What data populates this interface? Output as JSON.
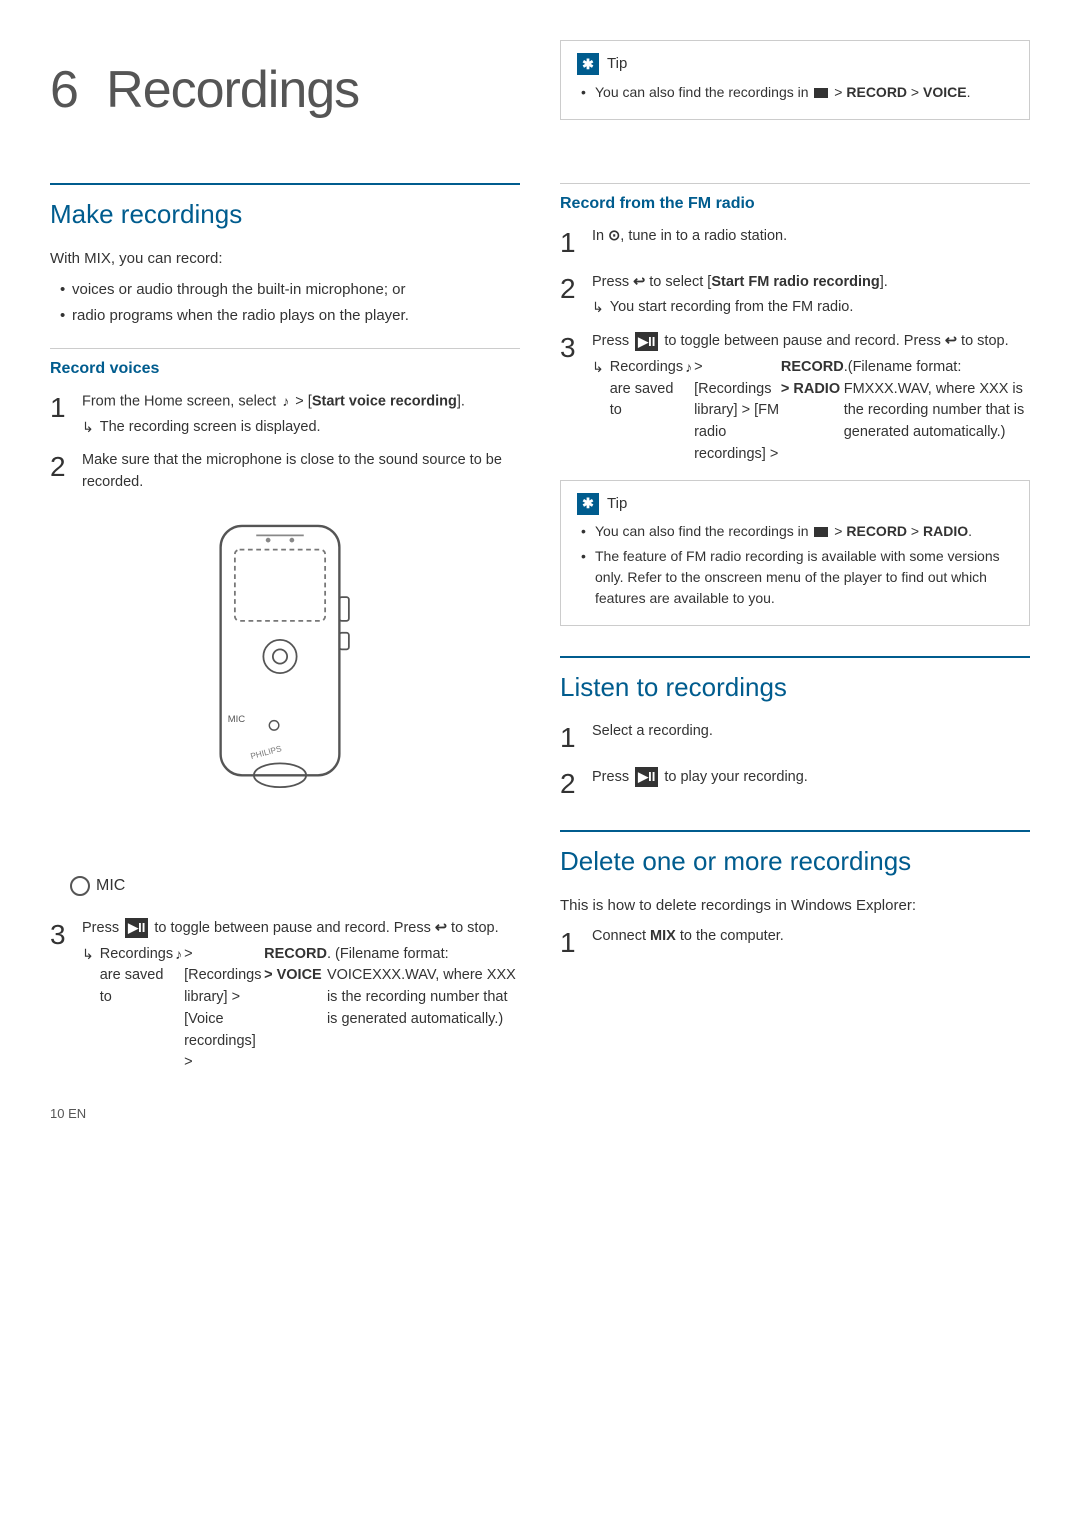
{
  "page": {
    "chapter_number": "6",
    "chapter_title": "Recordings",
    "footer": "10    EN"
  },
  "tip_top": {
    "label": "Tip",
    "items": [
      "You can also find the recordings in ■ > RECORD > VOICE."
    ]
  },
  "make_recordings": {
    "section_title": "Make recordings",
    "intro": "With MIX, you can record:",
    "bullets": [
      "voices or audio through the built-in microphone; or",
      "radio programs when the radio plays on the player."
    ],
    "record_voices": {
      "subtitle": "Record voices",
      "steps": [
        {
          "num": "1",
          "text": "From the Home screen, select ♪ > [Start voice recording].",
          "note": "The recording screen is displayed."
        },
        {
          "num": "2",
          "text": "Make sure that the microphone is close to the sound source to be recorded."
        },
        {
          "num": "3",
          "text": "Press ▶II to toggle between pause and record. Press ↩ to stop.",
          "note": "Recordings are saved to ♪ > [Recordings library] > [Voice recordings] > RECORD > VOICE. (Filename format: VOICEXXX.WAV, where XXX is the recording number that is generated automatically.)"
        }
      ]
    }
  },
  "record_fm": {
    "subtitle": "Record from the FM radio",
    "steps": [
      {
        "num": "1",
        "text": "In ⊙, tune in to a radio station."
      },
      {
        "num": "2",
        "text": "Press ↩ to select [Start FM radio recording].",
        "note": "You start recording from the FM radio."
      },
      {
        "num": "3",
        "text": "Press ▶II to toggle between pause and record. Press ↩ to stop.",
        "note": "Recordings are saved to ♪ > [Recordings library] > [FM radio recordings] > RECORD > RADIO.(Filename format: FMXXX.WAV, where XXX is the recording number that is generated automatically.)"
      }
    ]
  },
  "tip_radio": {
    "label": "Tip",
    "items": [
      "You can also find the recordings in ■ > RECORD > RADIO.",
      "The feature of FM radio recording is available with some versions only. Refer to the onscreen menu of the player to find out which features are available to you."
    ]
  },
  "listen_recordings": {
    "section_title": "Listen to recordings",
    "steps": [
      {
        "num": "1",
        "text": "Select a recording."
      },
      {
        "num": "2",
        "text": "Press ▶II to play your recording."
      }
    ]
  },
  "delete_recordings": {
    "section_title": "Delete one or more recordings",
    "intro": "This is how to delete recordings in Windows Explorer:",
    "steps": [
      {
        "num": "1",
        "text": "Connect MIX to the computer."
      }
    ]
  },
  "mic_label": "MIC"
}
